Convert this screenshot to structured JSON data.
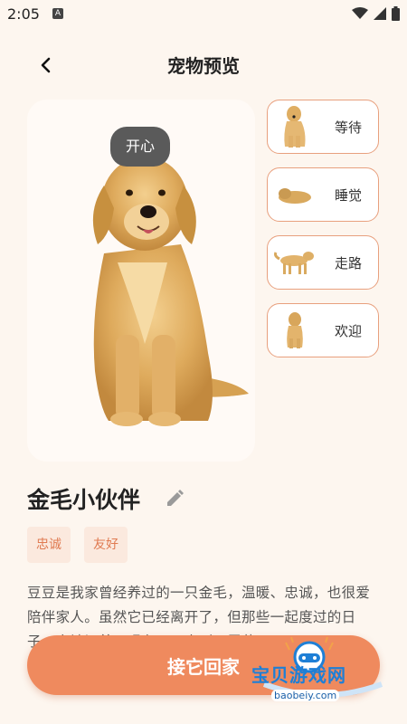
{
  "status_bar": {
    "time": "2:05",
    "notification_glyph": "A"
  },
  "header": {
    "title": "宠物预览",
    "back_icon": "chevron-left-icon"
  },
  "preview": {
    "mood_badge": "开心",
    "image": "golden-retriever-sitting"
  },
  "poses": [
    {
      "label": "等待",
      "thumb": "dog-sitting"
    },
    {
      "label": "睡觉",
      "thumb": "dog-lying"
    },
    {
      "label": "走路",
      "thumb": "dog-walking"
    },
    {
      "label": "欢迎",
      "thumb": "dog-standing"
    }
  ],
  "pet": {
    "name": "金毛小伙伴",
    "tags": [
      "忠诚",
      "友好"
    ],
    "description": "豆豆是我家曾经养过的一只金毛，温暖、忠诚，也很爱陪伴家人。虽然它已经离开了，但那些一起度过的日子，直被记着。现在可可来到了屋幕"
  },
  "cta": {
    "label": "接它回家"
  },
  "watermark": {
    "text": "宝贝游戏网",
    "url": "baobeiy.com"
  },
  "colors": {
    "accent": "#ef8a5e",
    "background": "#fdf6ef",
    "tag_bg": "#fbe9de",
    "tag_text": "#e07b52"
  }
}
